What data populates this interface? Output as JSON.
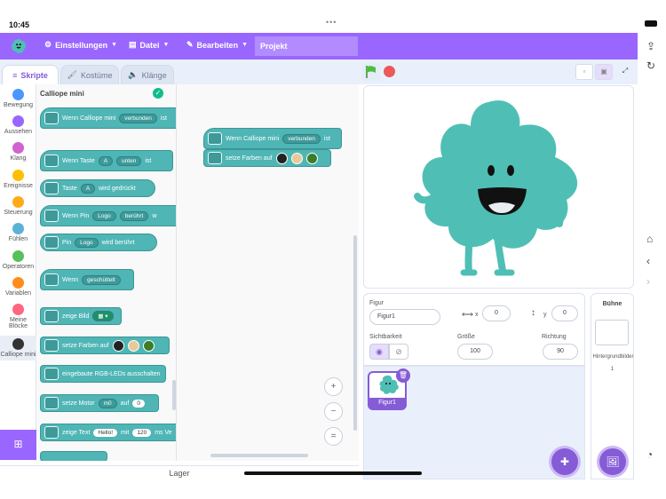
{
  "status": {
    "time": "10:45"
  },
  "menu": {
    "settings": "Einstellungen",
    "file": "Datei",
    "edit": "Bearbeiten",
    "project": "Projekt"
  },
  "tabs": {
    "scripts": "Skripte",
    "costumes": "Kostüme",
    "sounds": "Klänge"
  },
  "categories": [
    {
      "label": "Bewegung",
      "color": "#4c97ff"
    },
    {
      "label": "Aussehen",
      "color": "#9966ff"
    },
    {
      "label": "Klang",
      "color": "#cf63cf"
    },
    {
      "label": "Ereignisse",
      "color": "#ffbf00"
    },
    {
      "label": "Steuerung",
      "color": "#ffab19"
    },
    {
      "label": "Fühlen",
      "color": "#5cb1d6"
    },
    {
      "label": "Operatoren",
      "color": "#59c059"
    },
    {
      "label": "Variablen",
      "color": "#ff8c1a"
    },
    {
      "label": "Meine Blöcke",
      "color": "#ff6680"
    },
    {
      "label": "Calliope mini",
      "color": "#333333"
    }
  ],
  "palette": {
    "title": "Calliope mini",
    "blocks": {
      "b1": "Wenn Calliope mini",
      "b1_dd": "verbunden",
      "b1_tail": "ist",
      "b2": "Wenn Taste",
      "b2_dd1": "A",
      "b2_dd2": "unten",
      "b2_tail": "ist",
      "b3": "Taste",
      "b3_dd": "A",
      "b3_tail": "wird gedrückt",
      "b4": "Wenn Pin",
      "b4_dd1": "Logo",
      "b4_dd2": "berührt",
      "b4_tail": "w",
      "b5": "Pin",
      "b5_dd": "Logo",
      "b5_tail": "wird berührt",
      "b6": "Wenn",
      "b6_dd": "geschüttelt",
      "b7": "zeige Bild",
      "b8": "setze Farben auf",
      "b9": "eingebaute RGB-LEDs ausschalten",
      "b10": "setze Motor",
      "b10_dd": "m0",
      "b10_mid": "auf",
      "b10_val": "0",
      "b11": "zeige Text",
      "b11_val": "Hello!",
      "b11_mid": "mit",
      "b11_num": "120",
      "b11_tail": "ms Ve"
    }
  },
  "workspace": {
    "hat": "Wenn Calliope mini",
    "hat_dd": "verbunden",
    "hat_tail": "ist",
    "stmt": "setze Farben auf"
  },
  "zoom": {
    "in": "+",
    "out": "−",
    "reset": "="
  },
  "lager": "Lager",
  "sprite": {
    "label_sprite": "Figur",
    "name": "Figur1",
    "x_label": "x",
    "x": "0",
    "y_label": "y",
    "y": "0",
    "visibility_label": "Sichtbarkeit",
    "size_label": "Größe",
    "size": "100",
    "direction_label": "Richtung",
    "direction": "90",
    "thumb_name": "Figur1"
  },
  "stage_panel": {
    "title": "Bühne",
    "backdrops_label": "Hintergrundbilder",
    "backdrops_count": "1"
  },
  "colors": {
    "accent": "#9966ff",
    "block": "#4fb5b5",
    "sprite": "#4fbfb5"
  }
}
